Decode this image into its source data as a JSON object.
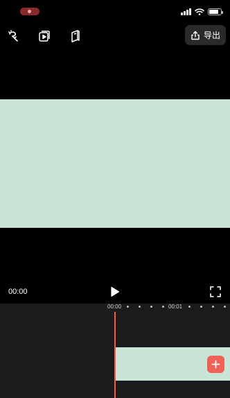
{
  "status_bar": {
    "recording_indicator": "recording-pill",
    "icons": [
      "cellular-signal-icon",
      "wifi-icon",
      "battery-icon"
    ]
  },
  "toolbar": {
    "icons": [
      "magic-wand-icon",
      "play-preview-icon",
      "book-icon"
    ],
    "export_label": "导出",
    "export_icon": "share-icon"
  },
  "preview": {
    "background_color": "#c9e5d8"
  },
  "playback": {
    "current_time": "00:00",
    "play_icon": "play-icon",
    "fullscreen_icon": "fullscreen-icon"
  },
  "timeline": {
    "ruler_labels": [
      "00:00",
      "00:01"
    ],
    "clip_color": "#c9e5d8",
    "playhead_color": "#ff5a3c",
    "add_button_color": "#f06257",
    "add_icon": "plus-icon"
  }
}
